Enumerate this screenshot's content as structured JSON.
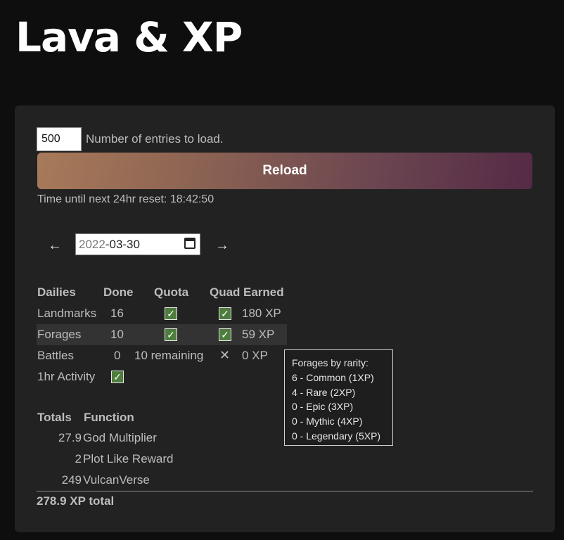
{
  "title": "Lava & XP",
  "entries": {
    "value": "500",
    "label": "Number of entries to load."
  },
  "reload_label": "Reload",
  "reset_text": "Time until next 24hr reset: 18:42:50",
  "date_nav": {
    "prev": "←",
    "next": "→",
    "year": "2022",
    "rest": "-03-30"
  },
  "dailies": {
    "headers": [
      "Dailies",
      "Done",
      "Quota",
      "Quad",
      "Earned"
    ],
    "rows": [
      {
        "name": "Landmarks",
        "done": "16",
        "quota": true,
        "quad": true,
        "earned": "180 XP"
      },
      {
        "name": "Forages",
        "done": "10",
        "quota": true,
        "quad": true,
        "earned": "59 XP"
      },
      {
        "name": "Battles",
        "done": "0",
        "quota_text": "10 remaining",
        "quad": false,
        "quad_mark": "✕",
        "earned": "0 XP"
      }
    ],
    "activity": {
      "label": "1hr Activity",
      "checked": true
    }
  },
  "tooltip": {
    "title": "Forages by rarity:",
    "lines": [
      "6 - Common (1XP)",
      "4 - Rare (2XP)",
      "0 - Epic (3XP)",
      "0 - Mythic (4XP)",
      "0 - Legendary (5XP)"
    ]
  },
  "totals": {
    "headers": [
      "Totals",
      "Function"
    ],
    "rows": [
      {
        "value": "27.9",
        "fn": "God Multiplier"
      },
      {
        "value": "2",
        "fn": "Plot Like Reward"
      },
      {
        "value": "249",
        "fn": "VulcanVerse"
      }
    ],
    "grand": "278.9 XP total"
  },
  "check_glyph": "✓"
}
